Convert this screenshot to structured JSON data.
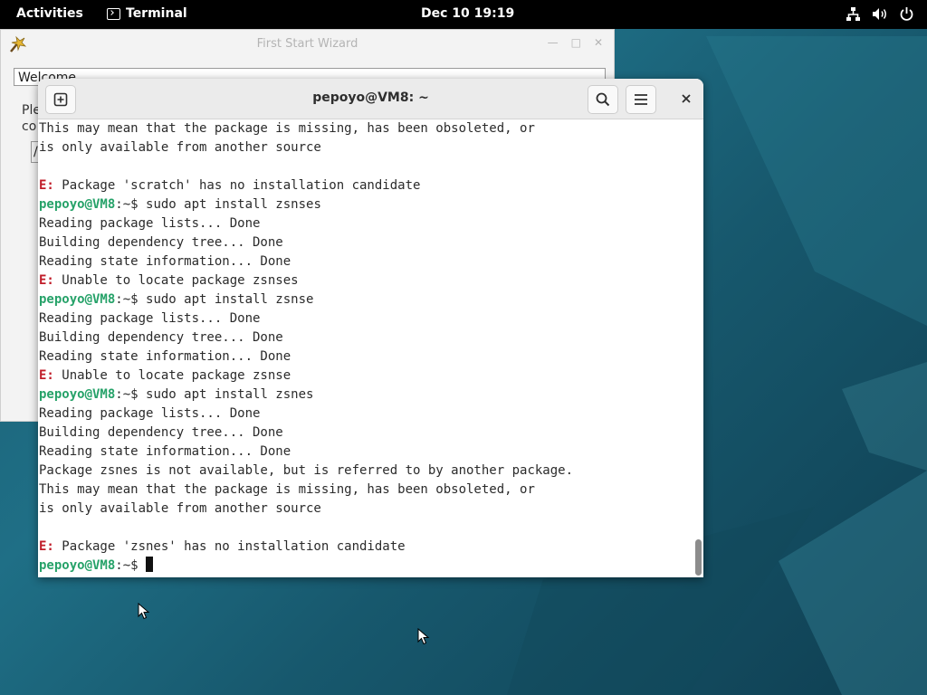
{
  "topbar": {
    "activities": "Activities",
    "app_name": "Terminal",
    "clock": "Dec 10  19:19",
    "tray_icons": [
      "network-icon",
      "volume-icon",
      "power-icon"
    ]
  },
  "wizard": {
    "title": "First Start Wizard",
    "tab_label": "Welcome",
    "desc_fragment_1": "Ple",
    "desc_fragment_2": "co",
    "input_fragment": "/"
  },
  "terminal": {
    "title": "pepoyo@VM8: ~",
    "prompt_user": "pepoyo@VM8",
    "prompt_suffix": ":~$",
    "lines": [
      {
        "type": "text",
        "text": "This may mean that the package is missing, has been obsoleted, or"
      },
      {
        "type": "text",
        "text": "is only available from another source"
      },
      {
        "type": "text",
        "text": ""
      },
      {
        "type": "error",
        "label": "E:",
        "text": " Package 'scratch' has no installation candidate"
      },
      {
        "type": "prompt",
        "text": " sudo apt install zsnses"
      },
      {
        "type": "text",
        "text": "Reading package lists... Done"
      },
      {
        "type": "text",
        "text": "Building dependency tree... Done"
      },
      {
        "type": "text",
        "text": "Reading state information... Done"
      },
      {
        "type": "error",
        "label": "E:",
        "text": " Unable to locate package zsnses"
      },
      {
        "type": "prompt",
        "text": " sudo apt install zsnse"
      },
      {
        "type": "text",
        "text": "Reading package lists... Done"
      },
      {
        "type": "text",
        "text": "Building dependency tree... Done"
      },
      {
        "type": "text",
        "text": "Reading state information... Done"
      },
      {
        "type": "error",
        "label": "E:",
        "text": " Unable to locate package zsnse"
      },
      {
        "type": "prompt",
        "text": " sudo apt install zsnes"
      },
      {
        "type": "text",
        "text": "Reading package lists... Done"
      },
      {
        "type": "text",
        "text": "Building dependency tree... Done"
      },
      {
        "type": "text",
        "text": "Reading state information... Done"
      },
      {
        "type": "text",
        "text": "Package zsnes is not available, but is referred to by another package."
      },
      {
        "type": "text",
        "text": "This may mean that the package is missing, has been obsoleted, or"
      },
      {
        "type": "text",
        "text": "is only available from another source"
      },
      {
        "type": "text",
        "text": ""
      },
      {
        "type": "error",
        "label": "E:",
        "text": " Package 'zsnes' has no installation candidate"
      }
    ],
    "current_input": " "
  }
}
